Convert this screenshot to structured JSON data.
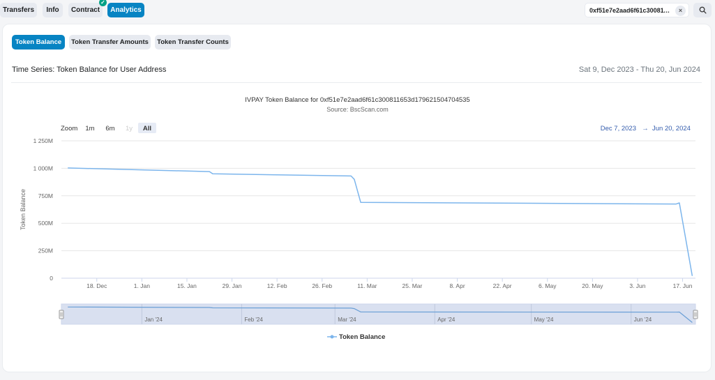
{
  "topbar": {
    "tabs": [
      {
        "label": "Transfers"
      },
      {
        "label": "Info"
      },
      {
        "label": "Contract"
      },
      {
        "label": "Analytics"
      }
    ],
    "address_value": "0xf51e7e2aad6f61c30081165...",
    "close_glyph": "×"
  },
  "card": {
    "subtabs": [
      {
        "label": "Token Balance"
      },
      {
        "label": "Token Transfer Amounts"
      },
      {
        "label": "Token Transfer Counts"
      }
    ],
    "section_title": "Time Series: Token Balance for User Address",
    "date_range": "Sat 9, Dec 2023 - Thu 20, Jun 2024"
  },
  "chart_data": {
    "type": "line",
    "title": "IVPAY Token Balance for 0xf51e7e2aad6f61c300811653d179621504704535",
    "subtitle": "Source: BscScan.com",
    "ylabel": "Token Balance",
    "ylim": [
      0,
      1250
    ],
    "y_ticks": [
      "0",
      "250M",
      "500M",
      "750M",
      "1 000M",
      "1 250M"
    ],
    "x_ticks": [
      "18. Dec",
      "1. Jan",
      "15. Jan",
      "29. Jan",
      "12. Feb",
      "26. Feb",
      "11. Mar",
      "25. Mar",
      "8. Apr",
      "22. Apr",
      "6. May",
      "20. May",
      "3. Jun",
      "17. Jun"
    ],
    "series": [
      {
        "name": "Token Balance",
        "color": "#7cb5ec",
        "x": [
          "2023-12-09",
          "2024-01-22",
          "2024-01-23",
          "2024-03-06",
          "2024-03-07",
          "2024-03-09",
          "2024-06-15",
          "2024-06-16",
          "2024-06-20"
        ],
        "values": [
          1003,
          970,
          950,
          930,
          900,
          690,
          675,
          685,
          20
        ]
      }
    ],
    "grid": true,
    "legend": "bottom-center",
    "range_selector": {
      "zoom_label": "Zoom",
      "buttons": [
        "1m",
        "6m",
        "1y",
        "All"
      ],
      "selected": "All",
      "from": "Dec 7, 2023",
      "arrow": "→",
      "to": "Jun 20, 2024"
    },
    "navigator_ticks": [
      "Jan '24",
      "Feb '24",
      "Mar '24",
      "Apr '24",
      "May '24",
      "Jun '24"
    ]
  }
}
